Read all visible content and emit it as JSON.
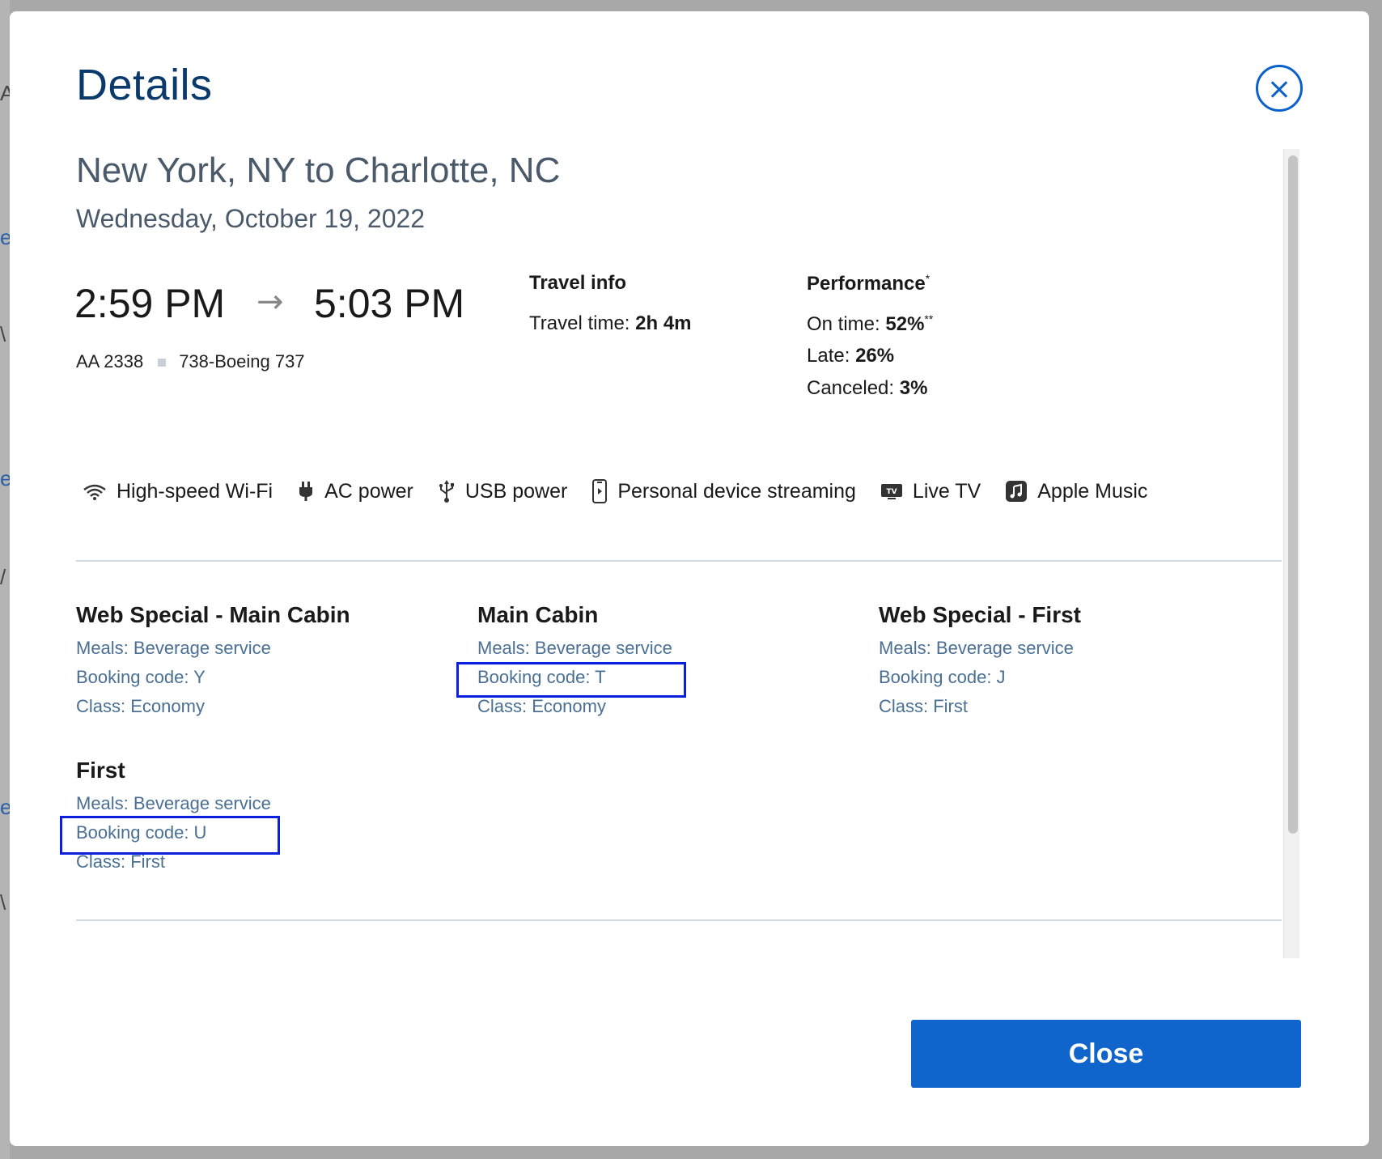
{
  "modal": {
    "title": "Details",
    "route": "New York, NY to Charlotte, NC",
    "date": "Wednesday, October 19, 2022"
  },
  "flight": {
    "departure_time": "2:59 PM",
    "arrival_time": "5:03 PM",
    "flight_number": "AA 2338",
    "aircraft": "738-Boeing 737"
  },
  "travel_info": {
    "heading": "Travel info",
    "travel_time_label": "Travel time:",
    "travel_time_value": "2h 4m"
  },
  "performance": {
    "heading": "Performance",
    "heading_mark": "*",
    "on_time_label": "On time:",
    "on_time_value": "52%",
    "on_time_mark": "**",
    "late_label": "Late:",
    "late_value": "26%",
    "canceled_label": "Canceled:",
    "canceled_value": "3%"
  },
  "amenities": [
    {
      "icon": "wifi-icon",
      "label": "High-speed Wi-Fi"
    },
    {
      "icon": "ac-power-icon",
      "label": "AC power"
    },
    {
      "icon": "usb-icon",
      "label": "USB power"
    },
    {
      "icon": "phone-icon",
      "label": "Personal device streaming"
    },
    {
      "icon": "tv-icon",
      "label": "Live TV"
    },
    {
      "icon": "music-icon",
      "label": "Apple Music"
    }
  ],
  "fares": [
    {
      "name": "Web Special - Main Cabin",
      "meals": "Meals: Beverage service",
      "booking_code": "Booking code: Y",
      "class": "Class: Economy"
    },
    {
      "name": "Main Cabin",
      "meals": "Meals: Beverage service",
      "booking_code": "Booking code: T",
      "class": "Class: Economy"
    },
    {
      "name": "Web Special - First",
      "meals": "Meals: Beverage service",
      "booking_code": "Booking code: J",
      "class": "Class: First"
    },
    {
      "name": "First",
      "meals": "Meals: Beverage service",
      "booking_code": "Booking code: U",
      "class": "Class: First"
    }
  ],
  "footer": {
    "close_label": "Close"
  },
  "colors": {
    "brand_blue": "#0f65cc",
    "title_blue": "#0a3a6b",
    "highlight": "#0b1fe0"
  }
}
